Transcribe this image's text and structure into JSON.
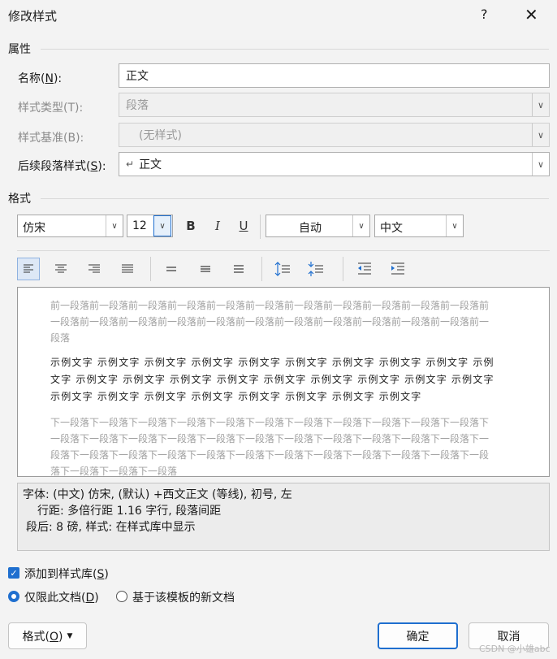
{
  "dialog": {
    "title": "修改样式",
    "help": "?",
    "close": "✕"
  },
  "properties": {
    "section_label": "属性",
    "name_label": "名称(N):",
    "name_value": "正文",
    "style_type_label": "样式类型(T):",
    "style_type_value": "段落",
    "style_based_label": "样式基准(B):",
    "style_based_value": "(无样式)",
    "next_style_label": "后续段落样式(S):",
    "next_style_value": "正文"
  },
  "format": {
    "section_label": "格式",
    "font": "仿宋",
    "size": "12",
    "bold": "B",
    "italic": "I",
    "underline": "U",
    "color": "自动",
    "script": "中文"
  },
  "preview": {
    "prev_para": "前一段落前一段落前一段落前一段落前一段落前一段落前一段落前一段落前一段落前一段落前一段落前一段落前一段落前一段落前一段落前一段落前一段落前一段落前一段落前一段落前一段落前一段落前一段落",
    "sample": "示例文字 示例文字 示例文字 示例文字 示例文字 示例文字 示例文字 示例文字 示例文字 示例文字 示例文字 示例文字 示例文字 示例文字 示例文字 示例文字 示例文字 示例文字 示例文字 示例文字 示例文字 示例文字 示例文字 示例文字 示例文字 示例文字 示例文字",
    "next_para": "下一段落下一段落下一段落下一段落下一段落下一段落下一段落下一段落下一段落下一段落下一段落下一段落下一段落下一段落下一段落下一段落下一段落下一段落下一段落下一段落下一段落下一段落下一段落下一段落下一段落下一段落下一段落下一段落下一段落下一段落下一段落下一段落下一段落下一段落下一段落下一段落下一段落"
  },
  "description": {
    "line1": "字体: (中文) 仿宋, (默认) +西文正文 (等线), 初号, 左",
    "line2": "行距: 多倍行距 1.16 字行, 段落间距",
    "line3": "段后: 8 磅, 样式: 在样式库中显示"
  },
  "options": {
    "add_to_gallery": "添加到样式库(S)",
    "this_doc_only": "仅限此文档(D)",
    "template_new_docs": "基于该模板的新文档"
  },
  "buttons": {
    "format": "格式(O)",
    "ok": "确定",
    "cancel": "取消"
  },
  "watermark": "CSDN @小雄abc"
}
